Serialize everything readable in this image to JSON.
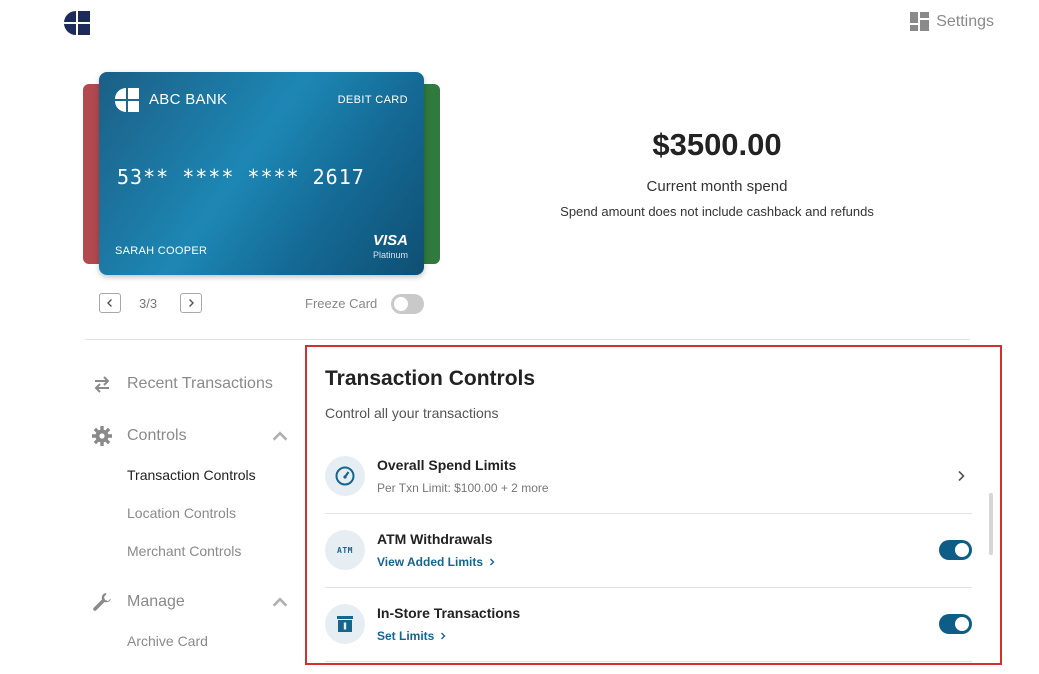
{
  "header": {
    "settings_label": "Settings"
  },
  "card": {
    "bank_name": "ABC BANK",
    "card_type": "DEBIT CARD",
    "number": "53** **** **** 2617",
    "holder": "SARAH COOPER",
    "network": "VISA",
    "tier": "Platinum"
  },
  "pager": {
    "text": "3/3"
  },
  "freeze": {
    "label": "Freeze Card",
    "enabled": false
  },
  "spend": {
    "amount": "$3500.00",
    "label": "Current month spend",
    "note": "Spend amount does not include cashback and refunds"
  },
  "sidebar": {
    "recent": "Recent Transactions",
    "controls": {
      "label": "Controls",
      "items": [
        "Transaction Controls",
        "Location Controls",
        "Merchant Controls"
      ]
    },
    "manage": {
      "label": "Manage",
      "items": [
        "Archive Card"
      ]
    }
  },
  "panel": {
    "title": "Transaction Controls",
    "subtitle": "Control all your transactions",
    "rows": [
      {
        "title": "Overall Spend Limits",
        "meta": "Per Txn Limit: $100.00 + 2 more"
      },
      {
        "title": "ATM Withdrawals",
        "link": "View Added Limits",
        "icon_text": "ATM",
        "enabled": true
      },
      {
        "title": "In-Store Transactions",
        "link": "Set Limits",
        "enabled": true
      }
    ]
  },
  "colors": {
    "accent": "#15658f",
    "toggle_on": "#0e5d86",
    "highlight_border": "#d32f2f"
  }
}
